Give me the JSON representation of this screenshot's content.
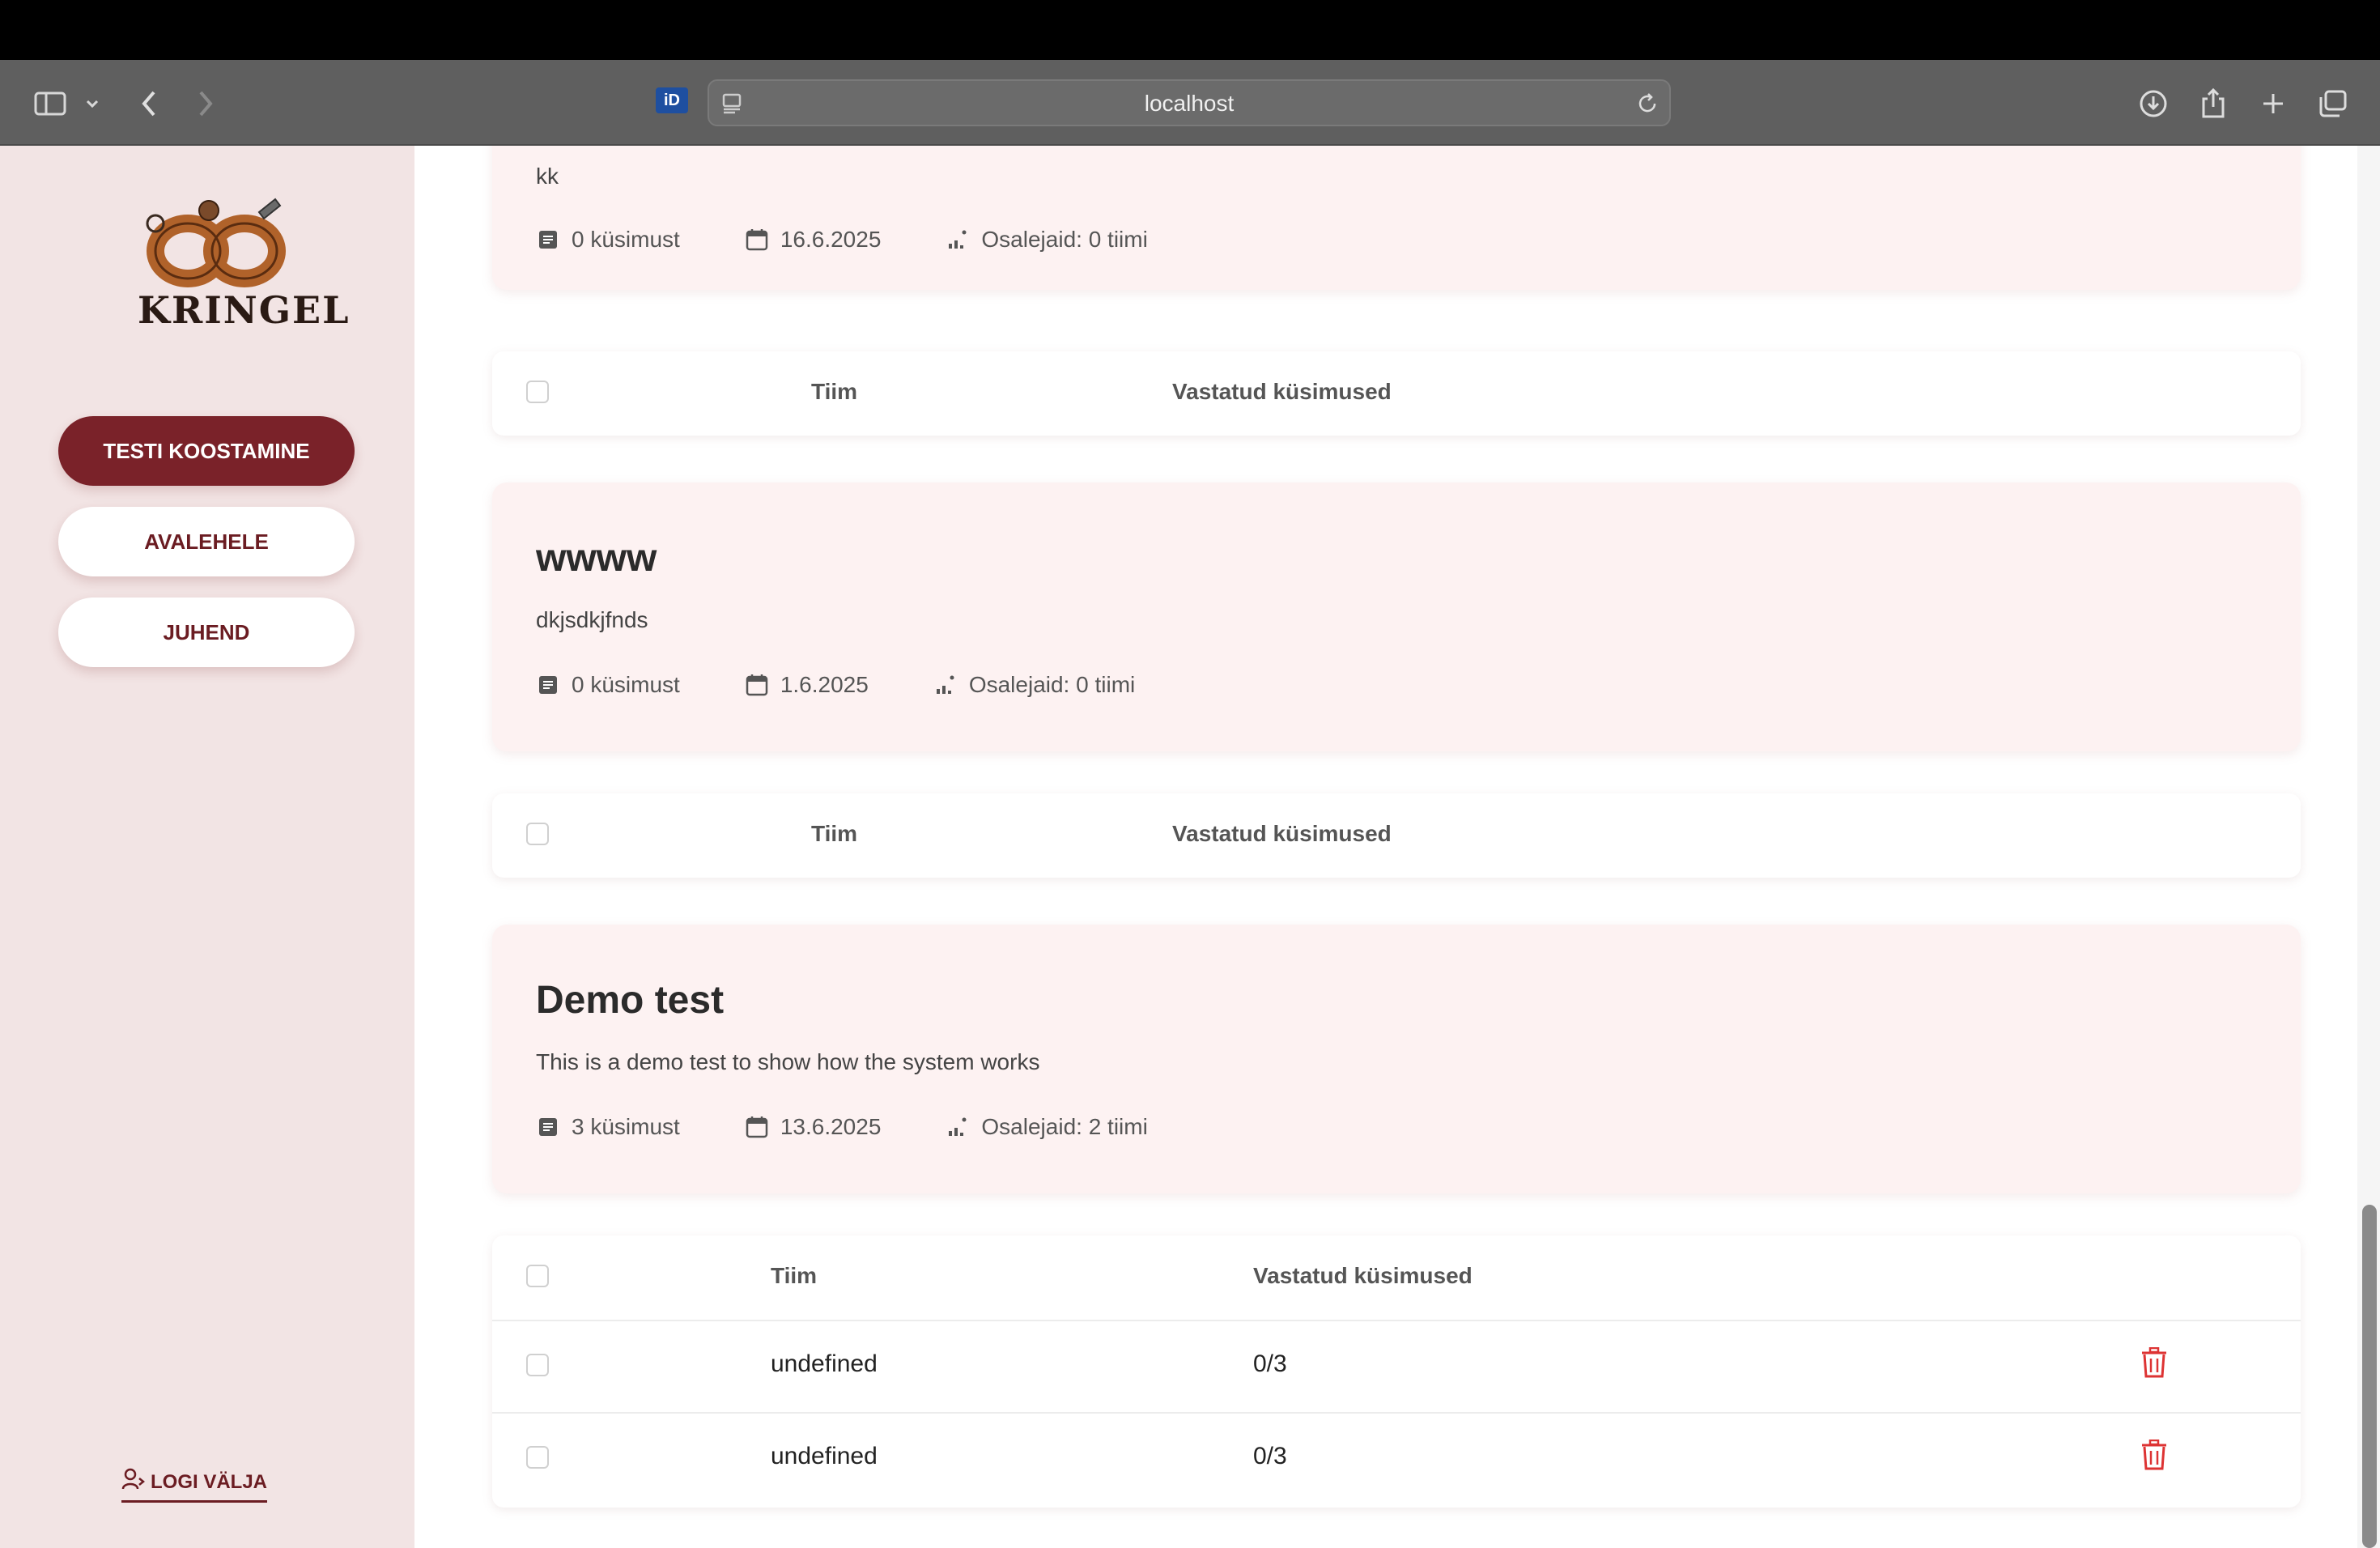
{
  "browser": {
    "url": "localhost",
    "id_badge": "iD"
  },
  "sidebar": {
    "logo_text": "KRINGEL",
    "nav": [
      {
        "label": "TESTI KOOSTAMINE"
      },
      {
        "label": "AVALEHELE"
      },
      {
        "label": "JUHEND"
      }
    ],
    "logout_label": "LOGI VÄLJA"
  },
  "tests": [
    {
      "title": "",
      "description": "kk",
      "questions": "0 küsimust",
      "date": "16.6.2025",
      "participants": "Osalejaid: 0 tiimi",
      "table_headers": {
        "team": "Tiim",
        "answered": "Vastatud küsimused"
      },
      "rows": []
    },
    {
      "title": "wwww",
      "description": "dkjsdkjfnds",
      "questions": "0 küsimust",
      "date": "1.6.2025",
      "participants": "Osalejaid: 0 tiimi",
      "table_headers": {
        "team": "Tiim",
        "answered": "Vastatud küsimused"
      },
      "rows": []
    },
    {
      "title": "Demo test",
      "description": "This is a demo test to show how the system works",
      "questions": "3 küsimust",
      "date": "13.6.2025",
      "participants": "Osalejaid: 2 tiimi",
      "table_headers": {
        "team": "Tiim",
        "answered": "Vastatud küsimused"
      },
      "rows": [
        {
          "team": "undefined",
          "answered": "0/3"
        },
        {
          "team": "undefined",
          "answered": "0/3"
        }
      ]
    }
  ],
  "colors": {
    "accent": "#7a2229",
    "card_bg": "#fdf2f2",
    "sidebar_bg": "#f2e4e4",
    "delete": "#d33333"
  }
}
